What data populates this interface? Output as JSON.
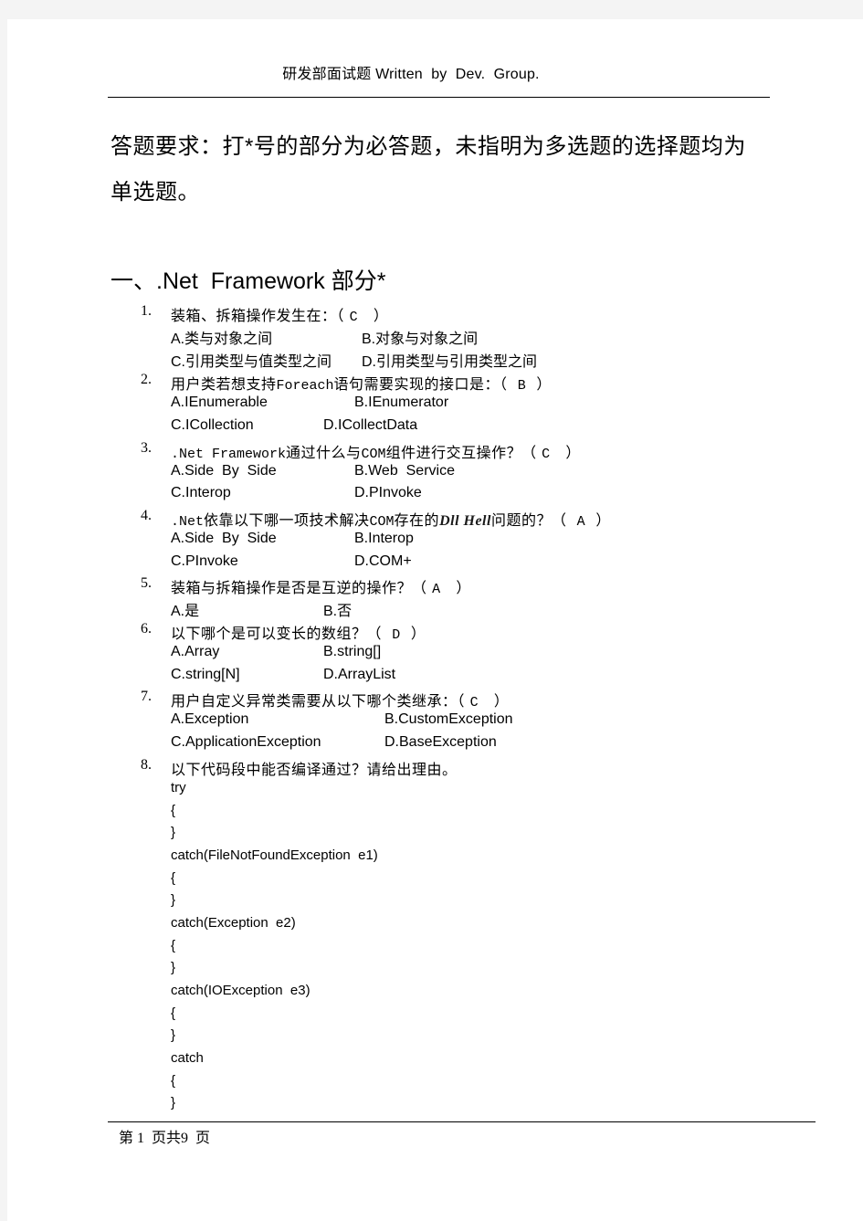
{
  "header": {
    "title": "研发部面试题 Written  by  Dev.  Group."
  },
  "instructions": {
    "line1": "答题要求：打*号的部分为必答题，未指明为多选题的选择题均为",
    "line2": "单选题。"
  },
  "section": {
    "title": "一、.Net  Framework 部分*"
  },
  "questions": [
    {
      "number": "1.",
      "text_parts": [
        "装箱、拆箱操作发生在：（ ",
        "C",
        "   ）"
      ],
      "options": [
        "A.类与对象之间",
        "B.对象与对象之间",
        "C.引用类型与值类型之间",
        "D.引用类型与引用类型之间"
      ]
    },
    {
      "number": "2.",
      "text_parts": [
        "用户类若想支持",
        "Foreach",
        "语句需要实现的接口是：（  ",
        "B",
        "  ）"
      ],
      "options": [
        "A.IEnumerable",
        "B.IEnumerator",
        "C.ICollection",
        "D.ICollectData"
      ]
    },
    {
      "number": "3.",
      "text_parts": [
        ".Net Framework",
        "通过什么与",
        "COM",
        "组件进行交互操作？（ ",
        "C",
        "   ）"
      ],
      "options": [
        "A.Side  By  Side",
        "B.Web  Service",
        "C.Interop",
        "D.PInvoke"
      ]
    },
    {
      "number": "4.",
      "text_parts": [
        ".Net",
        "依靠以下哪一项技术解决",
        "COM",
        "存在的",
        "Dll Hell",
        "问题的？（  ",
        "A",
        "  ）"
      ],
      "options": [
        "A.Side  By  Side",
        "B.Interop",
        "C.PInvoke",
        "D.COM+"
      ]
    },
    {
      "number": "5.",
      "text_parts": [
        "装箱与拆箱操作是否是互逆的操作？（ ",
        "A",
        "   ）"
      ],
      "options": [
        "A.是",
        "B.否"
      ]
    },
    {
      "number": "6.",
      "text_parts": [
        "以下哪个是可以变长的数组？（  ",
        "D",
        "  ）"
      ],
      "options": [
        "A.Array",
        "B.string[]",
        "C.string[N]",
        "D.ArrayList"
      ]
    },
    {
      "number": "7.",
      "text_parts": [
        "用户自定义异常类需要从以下哪个类继承：（ ",
        "C",
        "   ）"
      ],
      "options": [
        "A.Exception",
        "B.CustomException",
        "C.ApplicationException",
        "D.BaseException"
      ]
    },
    {
      "number": "8.",
      "text_parts": [
        "以下代码段中能否编译通过？请给出理由。"
      ],
      "code_lines": [
        "try",
        "{",
        "}",
        "catch(FileNotFoundException  e1)",
        "{",
        "}",
        "catch(Exception  e2)",
        "{",
        "}",
        "catch(IOException  e3)",
        "{",
        "}",
        "catch",
        "{",
        "}"
      ]
    }
  ],
  "footer": {
    "page_label": "第 1  页共9  页"
  }
}
